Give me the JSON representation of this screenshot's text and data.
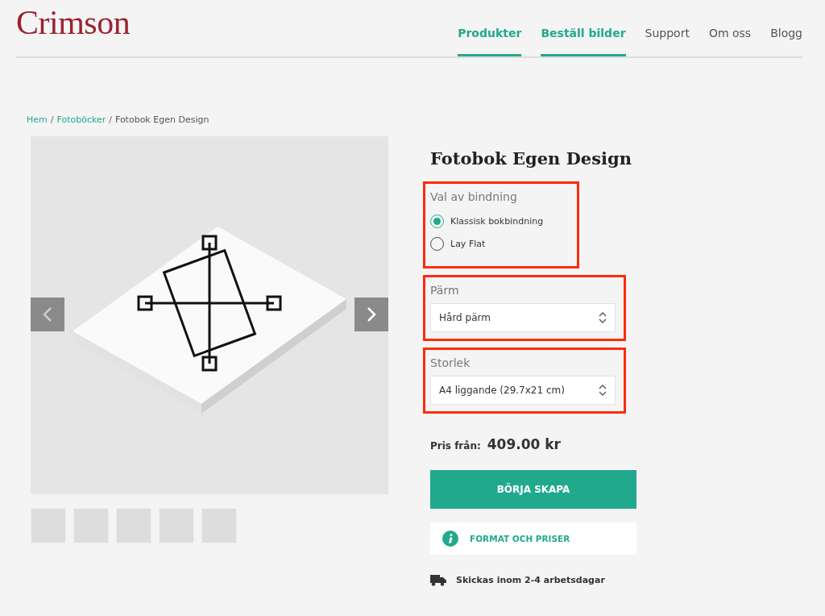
{
  "logo": "Crimson",
  "nav": [
    {
      "label": "Produkter",
      "active": true
    },
    {
      "label": "Beställ bilder",
      "active": true
    },
    {
      "label": "Support",
      "active": false
    },
    {
      "label": "Om oss",
      "active": false
    },
    {
      "label": "Blogg",
      "active": false
    }
  ],
  "breadcrumb": [
    {
      "label": "Hem",
      "link": true
    },
    {
      "label": "Fotoböcker",
      "link": true
    },
    {
      "label": "Fotobok Egen Design",
      "link": false
    }
  ],
  "breadcrumb_separator": "/",
  "product": {
    "title": "Fotobok Egen Design",
    "options": [
      {
        "kind": "radio",
        "label": "Val av bindning",
        "highlighted": true,
        "choices": [
          {
            "label": "Klassisk bokbindning",
            "selected": true
          },
          {
            "label": "Lay Flat",
            "selected": false
          }
        ]
      },
      {
        "kind": "select",
        "label": "Pärm",
        "highlighted": true,
        "value": "Hård pärm"
      },
      {
        "kind": "select",
        "label": "Storlek",
        "highlighted": true,
        "value": "A4 liggande (29.7x21 cm)"
      }
    ],
    "price_label": "Pris från:",
    "price": "409.00 kr",
    "primary_button": "BÖRJA SKAPA",
    "info_button": "FORMAT OCH PRISER",
    "shipping": "Skickas inom 2-4 arbetsdagar"
  }
}
